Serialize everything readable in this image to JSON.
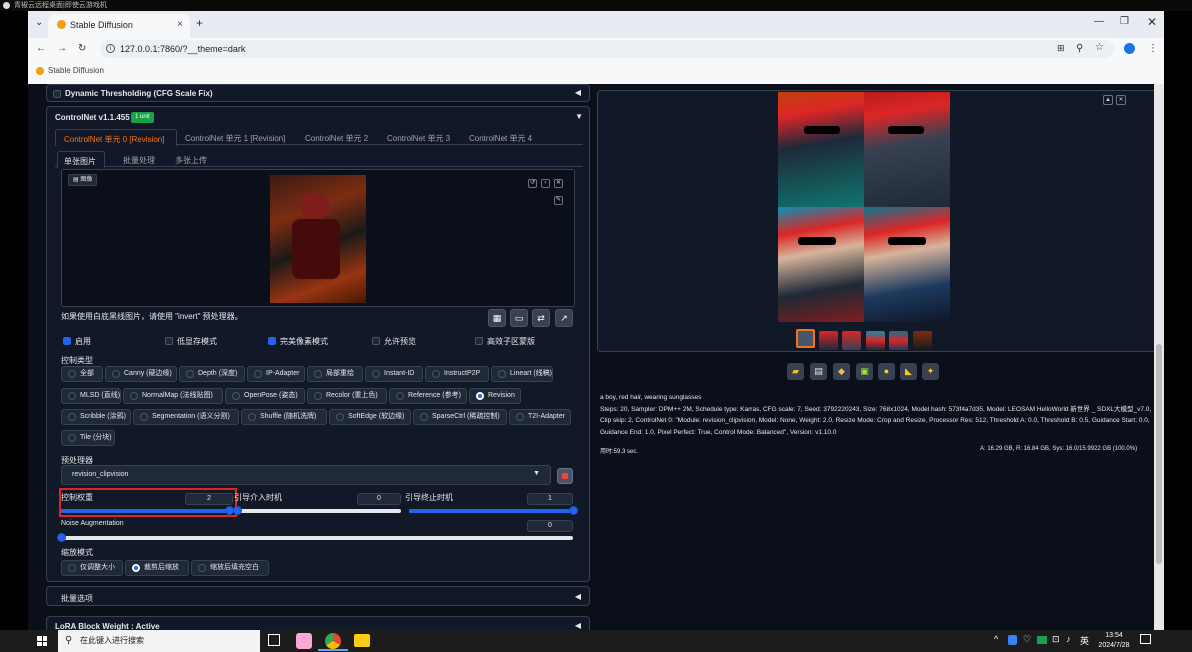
{
  "window": {
    "title_strip": "青椒云远程桌面|即使云游戏机"
  },
  "browser": {
    "tab_title": "Stable Diffusion",
    "url": "127.0.0.1:7860/?__theme=dark",
    "bookmark": "Stable Diffusion",
    "new_tab": "+",
    "close": "×"
  },
  "dynamic_thresholding": {
    "label": "Dynamic Thresholding (CFG Scale Fix)"
  },
  "controlnet": {
    "title": "ControlNet v1.1.455",
    "badge": "1 unit",
    "unit_tabs": [
      "ControlNet 单元 0 [Revision]",
      "ControlNet 单元 1 [Revision]",
      "ControlNet 单元 2",
      "ControlNet 单元 3",
      "ControlNet 单元 4"
    ],
    "image_tabs": [
      "单张图片",
      "批量处理",
      "多张上传"
    ],
    "image_label": "图像",
    "hint": "如果使用白底黑线图片，请使用 \"invert\" 预处理器。",
    "options": {
      "enable": "启用",
      "low_vram": "低显存模式",
      "pixel_perfect": "完美像素模式",
      "allow_preview": "允许预览",
      "efficient_mask": "高效子区蒙版"
    },
    "control_type_label": "控制类型",
    "control_types": [
      [
        "全部",
        "Canny (硬边缘)",
        "Depth (深度)",
        "IP-Adapter",
        "局部重绘",
        "Instant-ID",
        "InstructP2P",
        "Lineart (线稿)"
      ],
      [
        "MLSD (直线)",
        "NormalMap (法线贴图)",
        "OpenPose (姿态)",
        "Recolor (重上色)",
        "Reference (参考)",
        "Revision"
      ],
      [
        "Scribble (涂鸦)",
        "Segmentation (语义分割)",
        "Shuffle (随机洗牌)",
        "SoftEdge (软边缘)",
        "SparseCtrl (稀疏控制)",
        "T2I-Adapter"
      ],
      [
        "Tile (分块)"
      ]
    ],
    "selected_type": "Revision",
    "preprocessor_label": "预处理器",
    "preprocessor_value": "revision_clipvision",
    "control_weight_label": "控制权重",
    "control_weight": 2,
    "start_step_label": "引导介入时机",
    "start_step": 0,
    "end_step_label": "引导终止时机",
    "end_step": 1,
    "noise_aug_label": "Noise Augmentation",
    "noise_aug": 0,
    "resize_mode_label": "缩放模式",
    "resize_modes": [
      "仅调整大小",
      "裁剪后缩放",
      "缩放后填充空白"
    ],
    "resize_selected": "裁剪后缩放"
  },
  "batch_options": {
    "label": "批量选项"
  },
  "lora_block": {
    "label": "LoRA Block Weight : Active"
  },
  "output": {
    "prompt": "a boy, red hair, wearing sunglasses",
    "params": "Steps: 20, Sampler: DPM++ 2M, Schedule type: Karras, CFG scale: 7, Seed: 3792220243, Size: 768x1024, Model hash: 573f4a7d35, Model: LEOSAM HelloWorld 新世界 _ SDXL大模型_v7.0, Clip skip: 2, ControlNet 0: \"Module: revision_clipvision, Model: None, Weight: 2.0, Resize Mode: Crop and Resize, Processor Res: 512, Threshold A: 0.0, Threshold B: 0.5, Guidance Start: 0.0, Guidance End: 1.0, Pixel Perfect: True, Control Mode: Balanced\", Version: v1.10.0",
    "time": "用时:59.3 sec.",
    "vram": "A: 16.29 GB, R: 16.84 GB, Sys: 16.0/15.9922 GB (100.0%)"
  },
  "taskbar": {
    "search_placeholder": "在此键入进行搜索",
    "time": "13:54",
    "date": "2024/7/28",
    "lang": "英"
  },
  "colors": {
    "accent": "#2563eb",
    "badge": "#16a34a",
    "active_tab": "#f97316",
    "highlight_box": "#dc2626"
  }
}
